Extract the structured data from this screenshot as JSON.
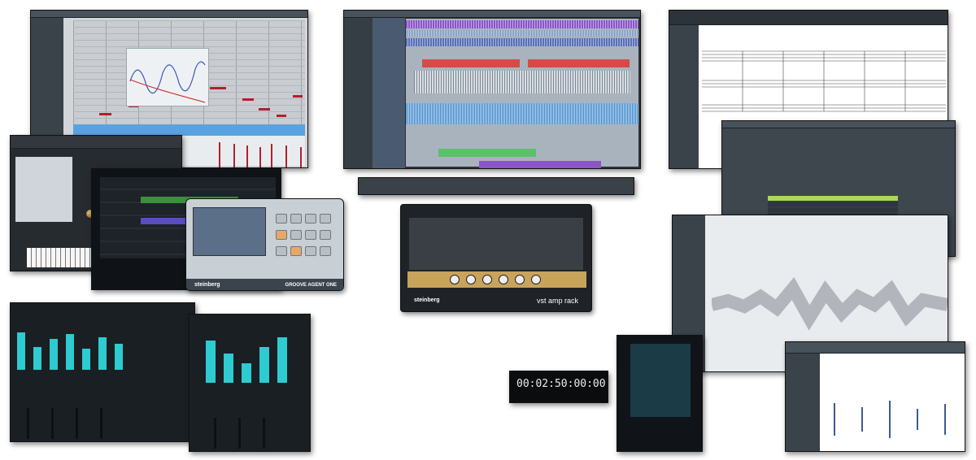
{
  "brand": {
    "name": "steinberg",
    "amp_product": "vst amp rack",
    "groove_product": "GROOVE AGENT ONE"
  },
  "transport": {
    "time_display": "00:02:50:00:00"
  },
  "accents": {
    "mixer_meter": "#2ecbd0",
    "midi_note": "#b0202e",
    "audio_event": "#4d8fcf",
    "amp_gold": "#c8a35a"
  },
  "icons": [
    "piano-keyboard-icon",
    "knob-icon",
    "fader-icon",
    "waveform-icon",
    "pad-icon"
  ]
}
